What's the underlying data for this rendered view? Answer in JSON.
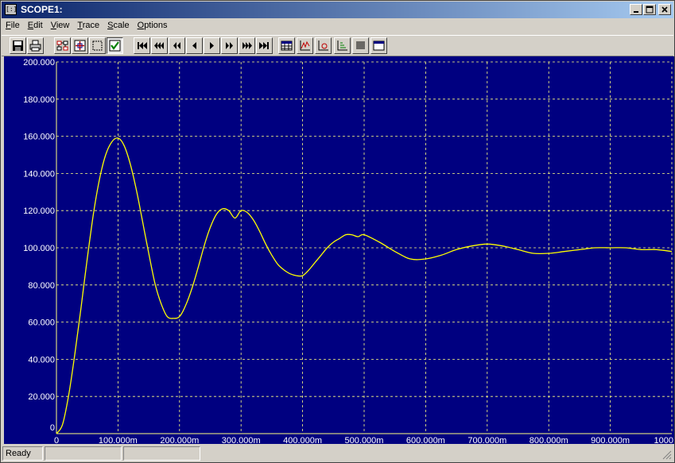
{
  "window": {
    "title": "SCOPE1:",
    "icon_text": "[:]"
  },
  "menu": [
    {
      "first": "F",
      "rest": "ile"
    },
    {
      "first": "E",
      "rest": "dit"
    },
    {
      "first": "V",
      "rest": "iew"
    },
    {
      "first": "T",
      "rest": "race"
    },
    {
      "first": "S",
      "rest": "cale"
    },
    {
      "first": "O",
      "rest": "ptions"
    }
  ],
  "toolbar": {
    "buttons": [
      "save-icon",
      "print-icon",
      "trace-properties-icon",
      "zoom-fit-icon",
      "zoom-area-icon",
      "check-traces-icon",
      "first-icon",
      "fast-back-icon",
      "back-icon",
      "step-back-icon",
      "step-forward-icon",
      "forward-icon",
      "fast-forward-icon",
      "last-icon",
      "table-icon",
      "line-trace-icon",
      "log-scale-icon",
      "axis-icon",
      "list-icon",
      "window-icon"
    ]
  },
  "status": {
    "text": "Ready"
  },
  "colors": {
    "plot_bg": "#000080",
    "grid": "#ffff80",
    "trace": "#ffff00",
    "axis_label": "#ffffff"
  },
  "chart_data": {
    "type": "line",
    "title": "",
    "xlabel": "",
    "ylabel": "",
    "xlim": [
      0,
      1000
    ],
    "ylim": [
      0,
      200
    ],
    "grid": true,
    "x_ticks": [
      "0",
      "100.000m",
      "200.000m",
      "300.000m",
      "400.000m",
      "500.000m",
      "600.000m",
      "700.000m",
      "800.000m",
      "900.000m",
      "1000"
    ],
    "y_ticks": [
      "0",
      "20.000",
      "40.000",
      "60.000",
      "80.000",
      "100.000",
      "120.000",
      "140.000",
      "160.000",
      "180.000",
      "200.000"
    ],
    "series": [
      {
        "x": [
          0,
          10,
          20,
          30,
          40,
          50,
          60,
          70,
          80,
          90,
          100,
          110,
          120,
          130,
          140,
          150,
          160,
          170,
          180,
          190,
          200,
          210,
          220,
          230,
          240,
          250,
          260,
          270,
          280,
          290,
          300,
          310,
          320,
          330,
          340,
          350,
          360,
          370,
          380,
          390,
          400,
          410,
          420,
          430,
          440,
          450,
          460,
          470,
          480,
          490,
          500,
          525,
          550,
          575,
          600,
          625,
          650,
          675,
          700,
          725,
          750,
          775,
          800,
          825,
          850,
          875,
          900,
          925,
          950,
          975,
          1000
        ],
        "y": [
          0,
          5,
          21,
          43,
          68,
          94,
          118,
          137,
          150,
          157,
          159,
          155,
          145,
          131,
          114,
          97,
          81,
          70,
          63,
          62,
          63,
          69,
          78,
          89,
          101,
          111,
          118,
          121,
          120,
          116,
          120,
          119,
          115,
          109,
          102,
          96,
          91,
          88,
          86,
          85,
          85,
          88,
          92,
          96,
          100,
          103,
          105,
          107,
          107,
          106,
          107,
          103,
          98,
          94,
          94,
          96,
          99,
          101,
          102,
          101,
          99,
          97,
          97,
          98,
          99,
          100,
          100,
          100,
          99,
          99,
          98
        ]
      }
    ]
  }
}
